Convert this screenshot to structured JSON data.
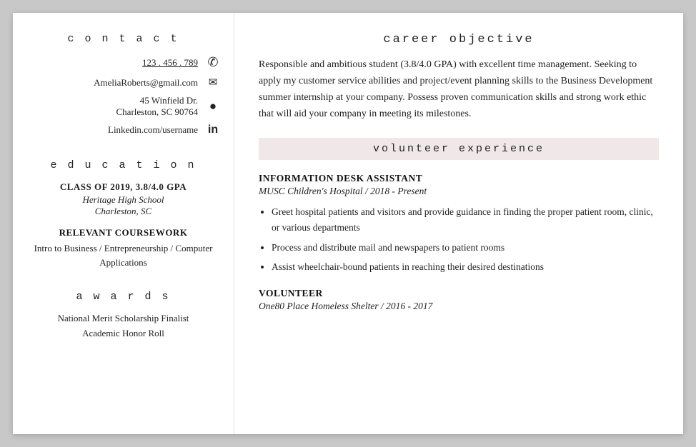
{
  "sidebar": {
    "contact_title": "c o n t a c t",
    "phone": "123 . 456 . 789",
    "email": "AmeliaRoberts@gmail.com",
    "address_line1": "45 Winfield Dr.",
    "address_line2": "Charleston, SC 90764",
    "linkedin": "Linkedin.com/username",
    "education_title": "e d u c a t i o n",
    "edu_class": "CLASS OF 2019, 3.8/4.0 GPA",
    "edu_school": "Heritage High School",
    "edu_city": "Charleston, SC",
    "relevant_title": "RELEVANT COURSEWORK",
    "relevant_courses": "Intro to Business / Entrepreneurship / Computer Applications",
    "awards_title": "a w a r d s",
    "award1": "National Merit Scholarship Finalist",
    "award2": "Academic Honor Roll"
  },
  "main": {
    "career_title": "career objective",
    "career_text": "Responsible and ambitious student (3.8/4.0 GPA) with excellent time management. Seeking to apply my customer service abilities and project/event planning skills to the Business Development summer internship at your company. Possess proven communication skills and strong work ethic that will aid your company in meeting its milestones.",
    "volunteer_title": "volunteer experience",
    "jobs": [
      {
        "title": "INFORMATION DESK ASSISTANT",
        "org": "MUSC Children's Hospital / 2018 - Present",
        "bullets": [
          "Greet hospital patients and visitors and provide guidance in finding the proper patient room, clinic, or various departments",
          "Process and distribute mail and newspapers to patient rooms",
          "Assist wheelchair-bound patients in reaching their desired destinations"
        ]
      },
      {
        "title": "VOLUNTEER",
        "org": "One80 Place Homeless Shelter / 2016 - 2017",
        "bullets": []
      }
    ]
  },
  "icons": {
    "phone": "✆",
    "email": "✉",
    "location": "◉",
    "linkedin": "in"
  }
}
